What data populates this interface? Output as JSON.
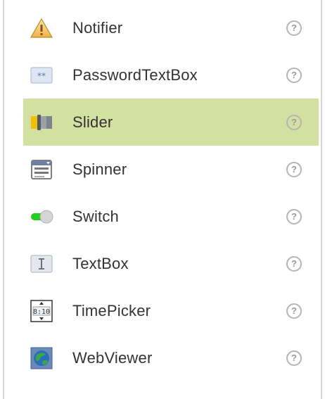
{
  "palette": {
    "components": [
      {
        "name": "Notifier",
        "icon": "warning-triangle-icon",
        "selected": false,
        "help": "?"
      },
      {
        "name": "PasswordTextBox",
        "icon": "password-field-icon",
        "selected": false,
        "help": "?"
      },
      {
        "name": "Slider",
        "icon": "slider-icon",
        "selected": true,
        "help": "?"
      },
      {
        "name": "Spinner",
        "icon": "spinner-dropdown-icon",
        "selected": false,
        "help": "?"
      },
      {
        "name": "Switch",
        "icon": "toggle-switch-icon",
        "selected": false,
        "help": "?"
      },
      {
        "name": "TextBox",
        "icon": "textbox-cursor-icon",
        "selected": false,
        "help": "?"
      },
      {
        "name": "TimePicker",
        "icon": "clock-time-icon",
        "selected": false,
        "help": "?"
      },
      {
        "name": "WebViewer",
        "icon": "globe-icon",
        "selected": false,
        "help": "?"
      }
    ]
  },
  "colors": {
    "selected_row": "#d3e0a2",
    "text": "#333333",
    "help_border": "#b5b5b5",
    "switch_green": "#22cc22"
  }
}
